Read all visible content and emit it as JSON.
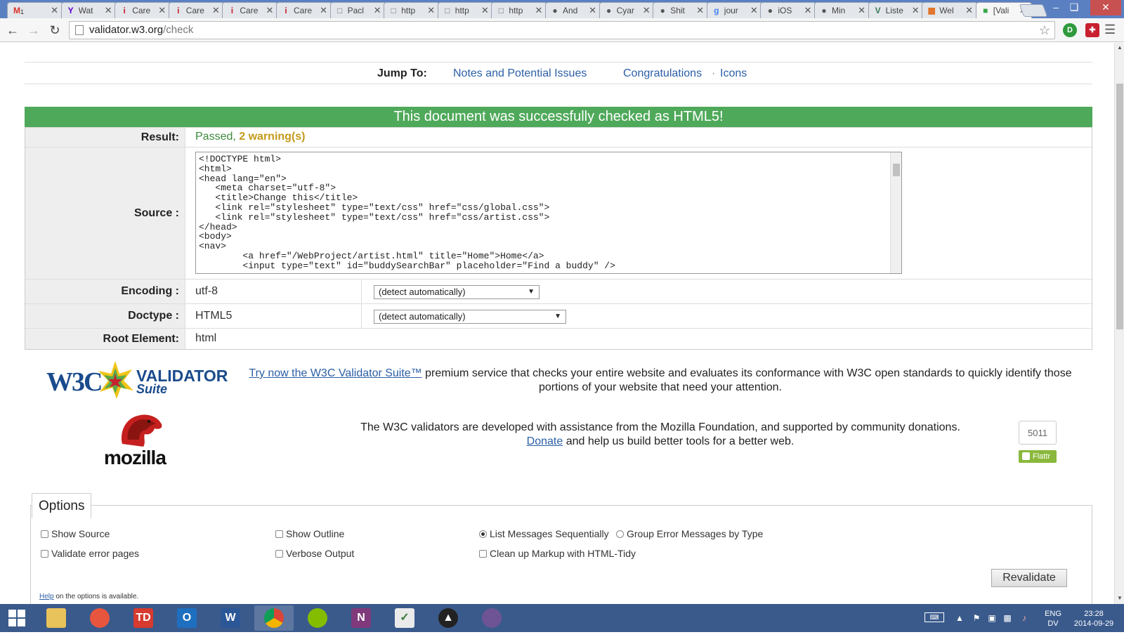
{
  "browser": {
    "tabs": [
      {
        "label": "",
        "icon": "gmail-icon"
      },
      {
        "label": "Wat",
        "icon": "yahoo-icon"
      },
      {
        "label": "Care",
        "icon": "info-icon"
      },
      {
        "label": "Care",
        "icon": "info-icon"
      },
      {
        "label": "Care",
        "icon": "info-icon"
      },
      {
        "label": "Care",
        "icon": "info-icon"
      },
      {
        "label": "Pacl",
        "icon": "page-icon"
      },
      {
        "label": "http",
        "icon": "page-icon"
      },
      {
        "label": "http",
        "icon": "page-icon"
      },
      {
        "label": "http",
        "icon": "page-icon"
      },
      {
        "label": "And",
        "icon": "reddit-icon"
      },
      {
        "label": "Cyar",
        "icon": "reddit-icon"
      },
      {
        "label": "Shit",
        "icon": "reddit-icon"
      },
      {
        "label": "jour",
        "icon": "google-icon"
      },
      {
        "label": "iOS",
        "icon": "apple-icon"
      },
      {
        "label": "Min",
        "icon": "apple-icon"
      },
      {
        "label": "Liste",
        "icon": "vue-icon"
      },
      {
        "label": "Wel",
        "icon": "ext-icon"
      },
      {
        "label": "[Vali",
        "icon": "w3c-tab-icon"
      }
    ],
    "gmail_count": "1",
    "url_host": "validator.w3.org",
    "url_path": "/check"
  },
  "page": {
    "jump_label": "Jump To:",
    "jump_links": [
      "Notes and Potential Issues",
      "Congratulations",
      "Icons"
    ],
    "jump_sep": "·",
    "banner": "This document was successfully checked as HTML5!",
    "result_label": "Result:",
    "result_passed": "Passed,",
    "result_warnings": "2 warning(s)",
    "source_label": "Source :",
    "source_code": "<!DOCTYPE html>\n<html>\n<head lang=\"en\">\n   <meta charset=\"utf-8\">\n   <title>Change this</title>\n   <link rel=\"stylesheet\" type=\"text/css\" href=\"css/global.css\">\n   <link rel=\"stylesheet\" type=\"text/css\" href=\"css/artist.css\">\n</head>\n<body>\n<nav>\n        <a href=\"/WebProject/artist.html\" title=\"Home\">Home</a>\n        <input type=\"text\" id=\"buddySearchBar\" placeholder=\"Find a buddy\" />",
    "encoding_label": "Encoding :",
    "encoding_value": "utf-8",
    "encoding_select": "(detect automatically)",
    "doctype_label": "Doctype :",
    "doctype_value": "HTML5",
    "doctype_select": "(detect automatically)",
    "root_label": "Root Element:",
    "root_value": "html",
    "validator_logo_w3c": "W3C",
    "validator_logo_title": "VALIDATOR",
    "validator_logo_suite": "Suite",
    "promo_link": "Try now the W3C Validator Suite™",
    "promo_text": " premium service that checks your entire website and evaluates its conformance with W3C open standards to quickly identify those portions of your website that need your attention.",
    "mozilla_logo": "mozilla",
    "mozilla_text": "The W3C validators are developed with assistance from the Mozilla Foundation, and supported by community donations.",
    "donate_link": "Donate",
    "donate_text": " and help us build better tools for a better web.",
    "flattr_count": "5011",
    "flattr_label": "Flattr"
  },
  "options": {
    "legend": "Options",
    "show_source": "Show Source",
    "show_outline": "Show Outline",
    "list_sequential": "List Messages Sequentially",
    "group_by_type": "Group Error Messages by Type",
    "validate_error_pages": "Validate error pages",
    "verbose_output": "Verbose Output",
    "cleanup_tidy": "Clean up Markup with HTML-Tidy",
    "help_link": "Help",
    "help_text": " on the options is available.",
    "revalidate": "Revalidate"
  },
  "taskbar": {
    "lang": "ENG",
    "lang2": "DV",
    "time": "23:28",
    "date": "2014-09-29"
  }
}
